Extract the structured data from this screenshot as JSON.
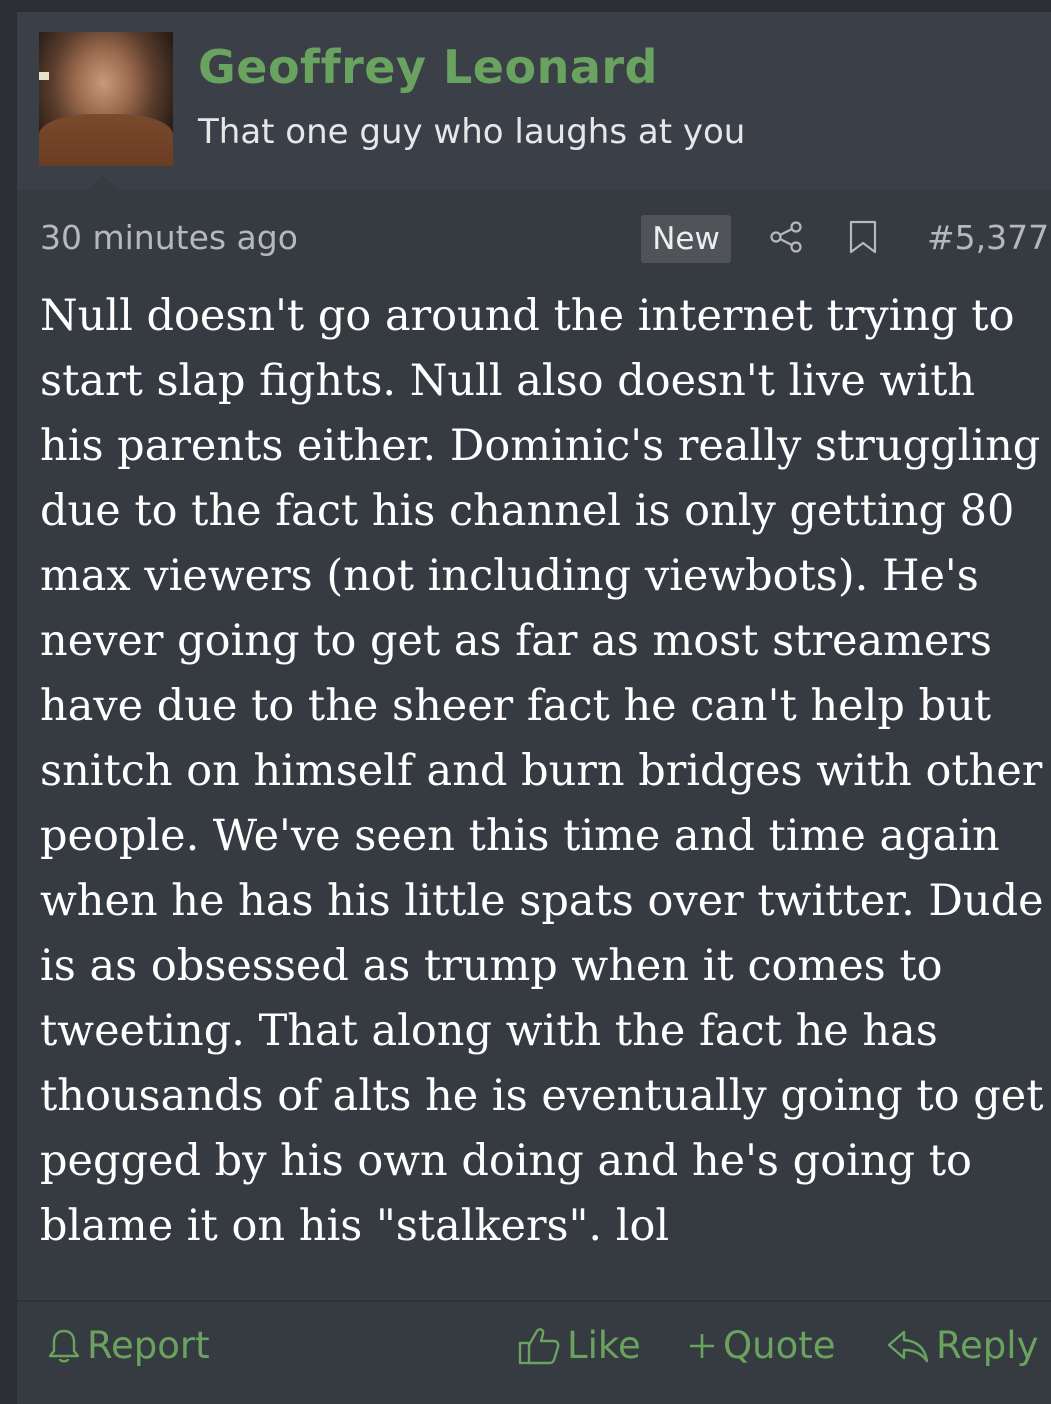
{
  "user": {
    "name": "Geoffrey Leonard",
    "title": "That one guy who laughs at you",
    "name_color": "#6aa35f"
  },
  "meta": {
    "timestamp": "30 minutes ago",
    "badge": "New",
    "post_number": "#5,377",
    "icons": [
      "share-icon",
      "bookmark-icon"
    ]
  },
  "post": {
    "body": "Null doesn't go around the internet trying to start slap fights. Null also doesn't live with his parents either. Dominic's really struggling due to the fact his channel is only getting 80 max viewers (not including viewbots). He's never going to get as far as most streamers have due to the sheer fact he can't help but snitch on himself and burn bridges with other people. We've seen this time and time again when he has his little spats over twitter. Dude is as obsessed as trump when it comes to tweeting. That along with the fact he has thousands of alts he is eventually going to get pegged by his own doing and he's going to blame it on his \"stalkers\". lol"
  },
  "actions": {
    "report": "Report",
    "like": "Like",
    "quote": "Quote",
    "reply": "Reply"
  }
}
